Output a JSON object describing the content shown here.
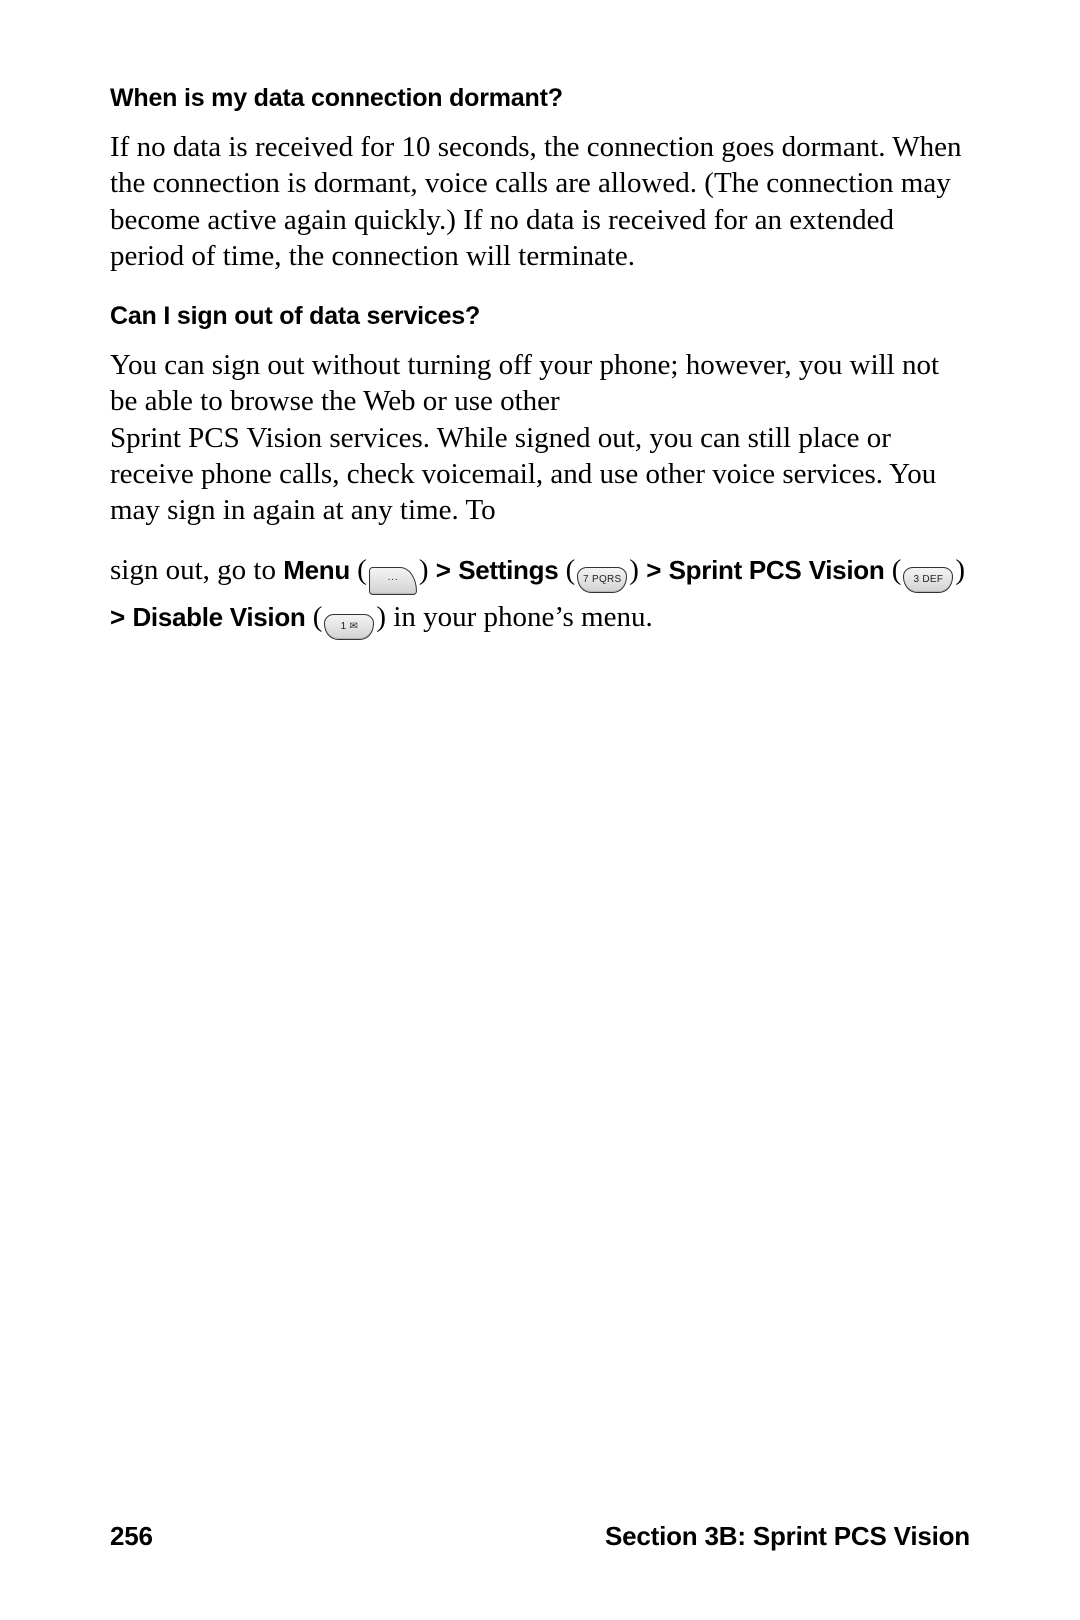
{
  "q1": {
    "heading": "When is my data connection dormant?",
    "body": "If no data is received for 10 seconds, the connection goes dormant. When the connection is dormant, voice calls are allowed. (The connection may become active again quickly.) If no data is received for an extended period of time, the connection will terminate."
  },
  "q2": {
    "heading": "Can I sign out of data services?",
    "body_a": "You can sign out without turning off your phone; however, you will not be able to browse the Web or use other",
    "body_b": "Sprint PCS Vision services. While signed out, you can still place or receive phone calls, check voicemail, and use other voice services. You may sign in again at any time. To",
    "nav": {
      "prefix": "sign out, go to ",
      "menu": "Menu",
      "settings": "Settings",
      "vision1": "Sprint PCS",
      "vision2": "Vision",
      "disable": "Disable Vision",
      "tail": " in your phone’s menu.",
      "sep": ">",
      "keys": {
        "menu": "···",
        "seven": "7 PQRS",
        "three": "3 DEF",
        "one": "1 ✉"
      }
    }
  },
  "footer": {
    "page": "256",
    "section": "Section 3B: Sprint PCS Vision"
  }
}
